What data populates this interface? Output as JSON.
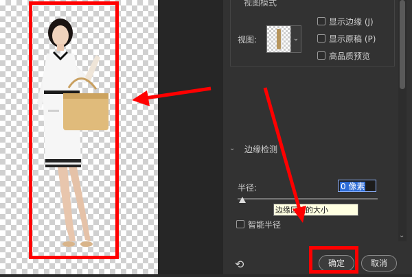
{
  "view_mode": {
    "legend": "视图模式",
    "view_label": "视图:",
    "options": [
      {
        "label": "显示边缘 (J)",
        "checked": false
      },
      {
        "label": "显示原稿 (P)",
        "checked": false
      },
      {
        "label": "高品质预览",
        "checked": false
      }
    ]
  },
  "edge_detection": {
    "section_title": "边缘检测",
    "radius_label": "半径:",
    "radius_value": "0 像素",
    "radius_slider_value": 0,
    "tooltip": "边缘区域的大小",
    "smart_radius_label": "智能半径",
    "smart_radius_checked": false
  },
  "buttons": {
    "ok": "确定",
    "cancel": "取消"
  },
  "icons": {
    "reset": "reset-icon",
    "expand": "chevron-down-icon"
  },
  "colors": {
    "highlight": "#ff0000",
    "panel_bg": "#323232",
    "field_selection": "#2c6bd6"
  }
}
